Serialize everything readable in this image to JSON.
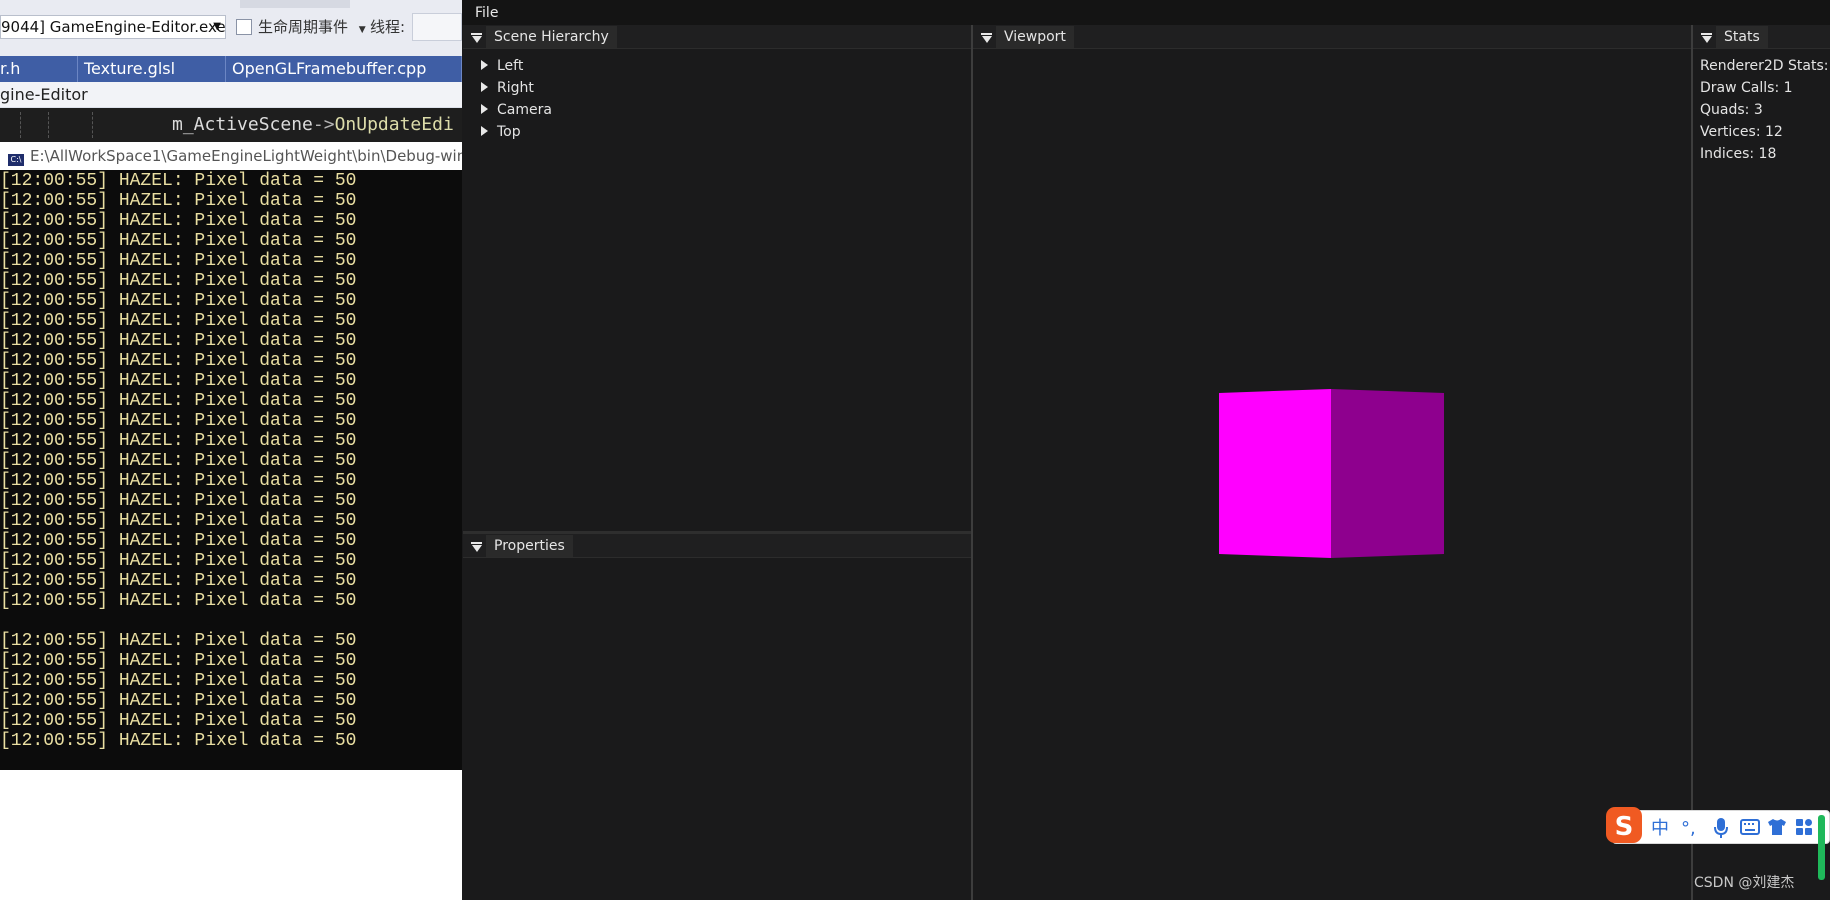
{
  "vs": {
    "process": "9044] GameEngine-Editor.exe",
    "lifecycle": "生命周期事件",
    "thread_label": "线程:",
    "tabs": [
      "r.h",
      "Texture.glsl",
      "OpenGLFramebuffer.cpp"
    ],
    "project": "gine-Editor",
    "code": {
      "object": "m_ActiveScene",
      "arrow": "->",
      "method": "OnUpdateEdi"
    },
    "console_title": "E:\\AllWorkSpace1\\GameEngineLightWeight\\bin\\Debug-win",
    "console_lines_a": [
      "[12:00:55] HAZEL: Pixel data = 50",
      "[12:00:55] HAZEL: Pixel data = 50",
      "[12:00:55] HAZEL: Pixel data = 50",
      "[12:00:55] HAZEL: Pixel data = 50",
      "[12:00:55] HAZEL: Pixel data = 50",
      "[12:00:55] HAZEL: Pixel data = 50",
      "[12:00:55] HAZEL: Pixel data = 50",
      "[12:00:55] HAZEL: Pixel data = 50",
      "[12:00:55] HAZEL: Pixel data = 50",
      "[12:00:55] HAZEL: Pixel data = 50",
      "[12:00:55] HAZEL: Pixel data = 50",
      "[12:00:55] HAZEL: Pixel data = 50",
      "[12:00:55] HAZEL: Pixel data = 50",
      "[12:00:55] HAZEL: Pixel data = 50",
      "[12:00:55] HAZEL: Pixel data = 50",
      "[12:00:55] HAZEL: Pixel data = 50",
      "[12:00:55] HAZEL: Pixel data = 50",
      "[12:00:55] HAZEL: Pixel data = 50",
      "[12:00:55] HAZEL: Pixel data = 50",
      "[12:00:55] HAZEL: Pixel data = 50",
      "[12:00:55] HAZEL: Pixel data = 50",
      "[12:00:55] HAZEL: Pixel data = 50"
    ],
    "console_lines_b": [
      "[12:00:55] HAZEL: Pixel data = 50",
      "[12:00:55] HAZEL: Pixel data = 50",
      "[12:00:55] HAZEL: Pixel data = 50",
      "[12:00:55] HAZEL: Pixel data = 50",
      "[12:00:55] HAZEL: Pixel data = 50",
      "[12:00:55] HAZEL: Pixel data = 50"
    ]
  },
  "editor": {
    "menu": {
      "file": "File"
    },
    "hierarchy": {
      "title": "Scene Hierarchy",
      "entities": [
        "Left",
        "Right",
        "Camera",
        "Top"
      ]
    },
    "properties": {
      "title": "Properties"
    },
    "viewport": {
      "title": "Viewport",
      "cube_colors": {
        "front": "#ff00ff",
        "side": "#8e008e"
      }
    },
    "stats": {
      "title": "Stats",
      "header": "Renderer2D Stats:",
      "draw_calls": "Draw Calls: 1",
      "quads": "Quads: 3",
      "vertices": "Vertices: 12",
      "indices": "Indices: 18"
    }
  },
  "ime": {
    "logo": "S",
    "items": [
      "中",
      "°,",
      "mic-icon",
      "keyboard-icon",
      "shirt-icon",
      "grid-icon"
    ],
    "zh": "中",
    "punct": "°,"
  },
  "watermark": "CSDN @刘建杰"
}
